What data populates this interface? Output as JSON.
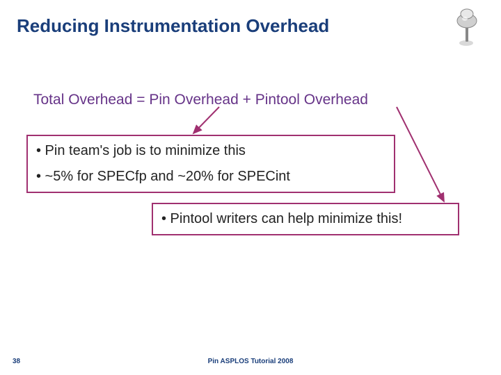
{
  "title": "Reducing Instrumentation Overhead",
  "equation": "Total Overhead = Pin Overhead + Pintool Overhead",
  "box1": {
    "line1": "• Pin team's job is to minimize this",
    "line2": "• ~5% for SPECfp and ~20% for SPECint"
  },
  "box2": {
    "line1": "• Pintool writers can help minimize this!"
  },
  "slidenum": "38",
  "footer": "Pin ASPLOS Tutorial 2008",
  "colors": {
    "heading": "#1a3e7a",
    "accent": "#663388",
    "boxborder": "#a03070"
  }
}
